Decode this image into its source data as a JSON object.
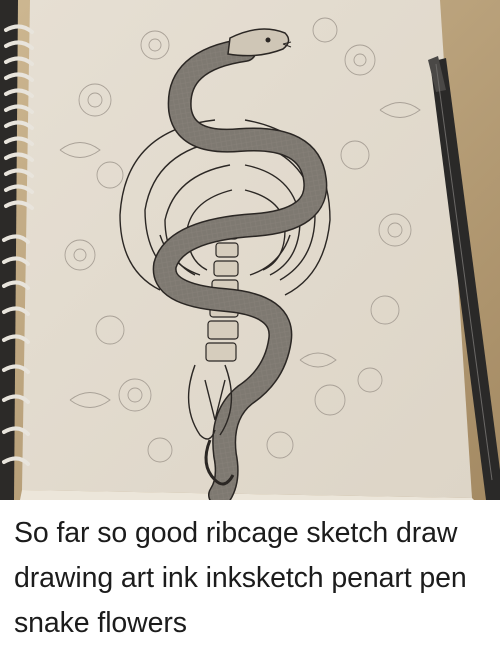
{
  "post": {
    "caption": "So far so good ribcage sketch draw drawing art ink inksketch penart pen snake flowers"
  },
  "colors": {
    "paper": "#e4ddd1",
    "background_table": "#b8a27f",
    "ink": "#2b2724",
    "pencil_flowers": "#a9a197",
    "sketchbook_edge": "#ede8de",
    "caption_text": "#1c1c1c"
  },
  "icons": [
    "ribcage-drawing",
    "snake-drawing",
    "flowers-drawing",
    "ink-pen",
    "spiral-binding"
  ]
}
